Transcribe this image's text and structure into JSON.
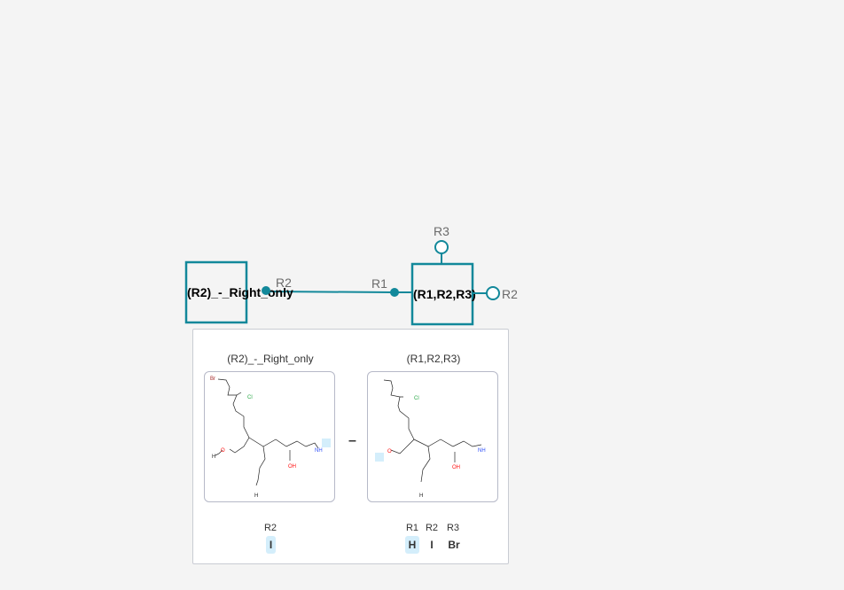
{
  "monomers": {
    "left": {
      "label": "(R2)_-_Right_only",
      "attachments": [
        "R2"
      ]
    },
    "right": {
      "label": "(R1,R2,R3)",
      "attachments": [
        "R1",
        "R3",
        "R2"
      ]
    }
  },
  "bond": {
    "from": "R2",
    "to": "R1"
  },
  "colors": {
    "accent": "#12889a",
    "highlight": "#d4eefb",
    "cl": "#28a745",
    "n": "#3050f8",
    "o": "#ff0d0d",
    "br": "#a62929"
  },
  "preview": {
    "left": {
      "title": "(R2)_-_Right_only",
      "atoms": {
        "br": "Br",
        "cl": "Cl",
        "o": "O",
        "h1": "H",
        "nh": "NH",
        "oh": "OH",
        "h2": "H"
      },
      "ap_headers": [
        "R2"
      ],
      "ap_values": [
        "I"
      ]
    },
    "separator": "–",
    "right": {
      "title": "(R1,R2,R3)",
      "atoms": {
        "cl": "Cl",
        "o": "O",
        "nh": "NH",
        "oh": "OH",
        "h": "H"
      },
      "ap_headers": [
        "R1",
        "R2",
        "R3"
      ],
      "ap_values": [
        "H",
        "I",
        "Br"
      ]
    }
  }
}
